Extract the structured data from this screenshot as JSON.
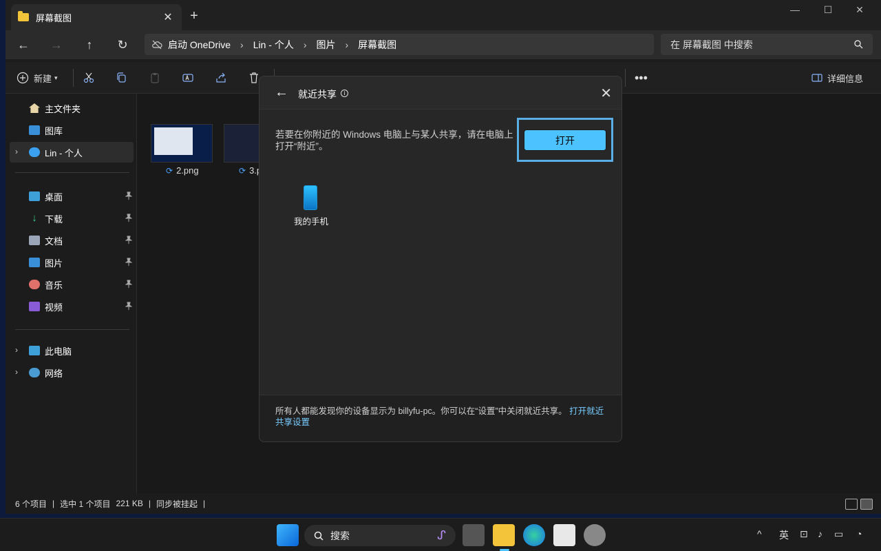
{
  "window": {
    "tab_title": "屏幕截图",
    "controls": [
      "minimize",
      "maximize",
      "close"
    ]
  },
  "address": {
    "items": [
      "启动 OneDrive",
      "Lin - 个人",
      "图片",
      "屏幕截图"
    ]
  },
  "search": {
    "placeholder": "在 屏幕截图 中搜索"
  },
  "toolbar": {
    "new_label": "新建",
    "details_label": "详细信息"
  },
  "sidebar": {
    "top": [
      {
        "label": "主文件夹"
      },
      {
        "label": "图库"
      },
      {
        "label": "Lin - 个人"
      }
    ],
    "pinned": [
      {
        "label": "桌面"
      },
      {
        "label": "下载"
      },
      {
        "label": "文档"
      },
      {
        "label": "图片"
      },
      {
        "label": "音乐"
      },
      {
        "label": "视频"
      }
    ],
    "devices": [
      {
        "label": "此电脑"
      },
      {
        "label": "网络"
      }
    ]
  },
  "files": [
    {
      "name": "2.png"
    },
    {
      "name": "3.p"
    }
  ],
  "status": {
    "count": "6 个项目",
    "selected": "选中 1 个项目",
    "size": "221 KB",
    "sync": "同步被挂起"
  },
  "dialog": {
    "title": "就近共享",
    "message": "若要在你附近的 Windows 电脑上与某人共享，请在电脑上打开“附近”。",
    "open_button": "打开",
    "device": "我的手机",
    "footer_text": "所有人都能发现你的设备显示为 billyfu-pc。你可以在“设置”中关闭就近共享。",
    "footer_link": "打开就近共享设置"
  },
  "taskbar": {
    "search_label": "搜索",
    "ime": "英"
  },
  "colors": {
    "accent": "#4cc2ff",
    "highlight_frame": "#5aaee6",
    "folder": "#f3c339"
  }
}
